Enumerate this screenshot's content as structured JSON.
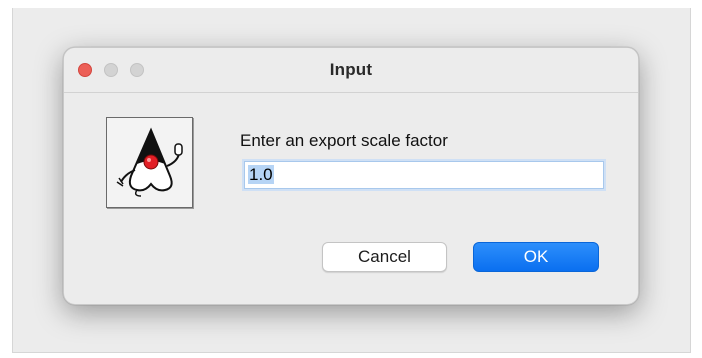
{
  "dialog": {
    "title": "Input",
    "window_controls": [
      "close",
      "minimize",
      "zoom"
    ],
    "icon": "java-duke-icon",
    "prompt": "Enter an export scale factor",
    "input": {
      "value": "1.0",
      "selected": true
    },
    "buttons": {
      "cancel_label": "Cancel",
      "ok_label": "OK"
    }
  },
  "colors": {
    "accent": "#0a6ff0",
    "close_button": "#ec5f57",
    "selection": "#b6d4f5"
  }
}
